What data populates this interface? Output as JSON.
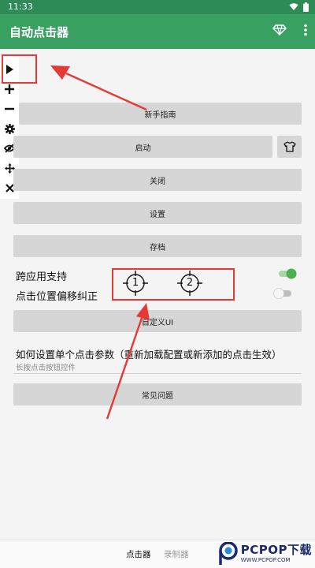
{
  "status_bar": {
    "time": "11:33"
  },
  "app_bar": {
    "title": "自动点击器"
  },
  "floating_panel": {
    "icons": [
      "play-icon",
      "plus-icon",
      "minus-icon",
      "gear-icon",
      "eye-off-icon",
      "move-icon",
      "close-icon"
    ]
  },
  "buttons": {
    "guide": "新手指南",
    "start": "启动",
    "close": "关闭",
    "settings": "设置",
    "save": "存档",
    "custom_ui": "自定义UI",
    "faq": "常见问题"
  },
  "settings": {
    "cross_app": {
      "label": "跨应用支持",
      "enabled": true
    },
    "offset_fix": {
      "label": "点击位置偏移纠正",
      "enabled": false
    }
  },
  "markers": [
    "1",
    "2"
  ],
  "single_click": {
    "title": "如何设置单个点击参数（重新加载配置或新添加的点击生效）",
    "subtitle": "长按点击按钮控件"
  },
  "bottom_nav": {
    "clicker": "点击器",
    "recorder": "录制器"
  },
  "watermark": {
    "brand": "PCPOP下载",
    "url": "WWW.PCPOP.COM"
  },
  "colors": {
    "primary": "#38a061",
    "status_bar": "#2e8b57",
    "annotation": "#e53935",
    "toggle_on": "#4caf50"
  }
}
